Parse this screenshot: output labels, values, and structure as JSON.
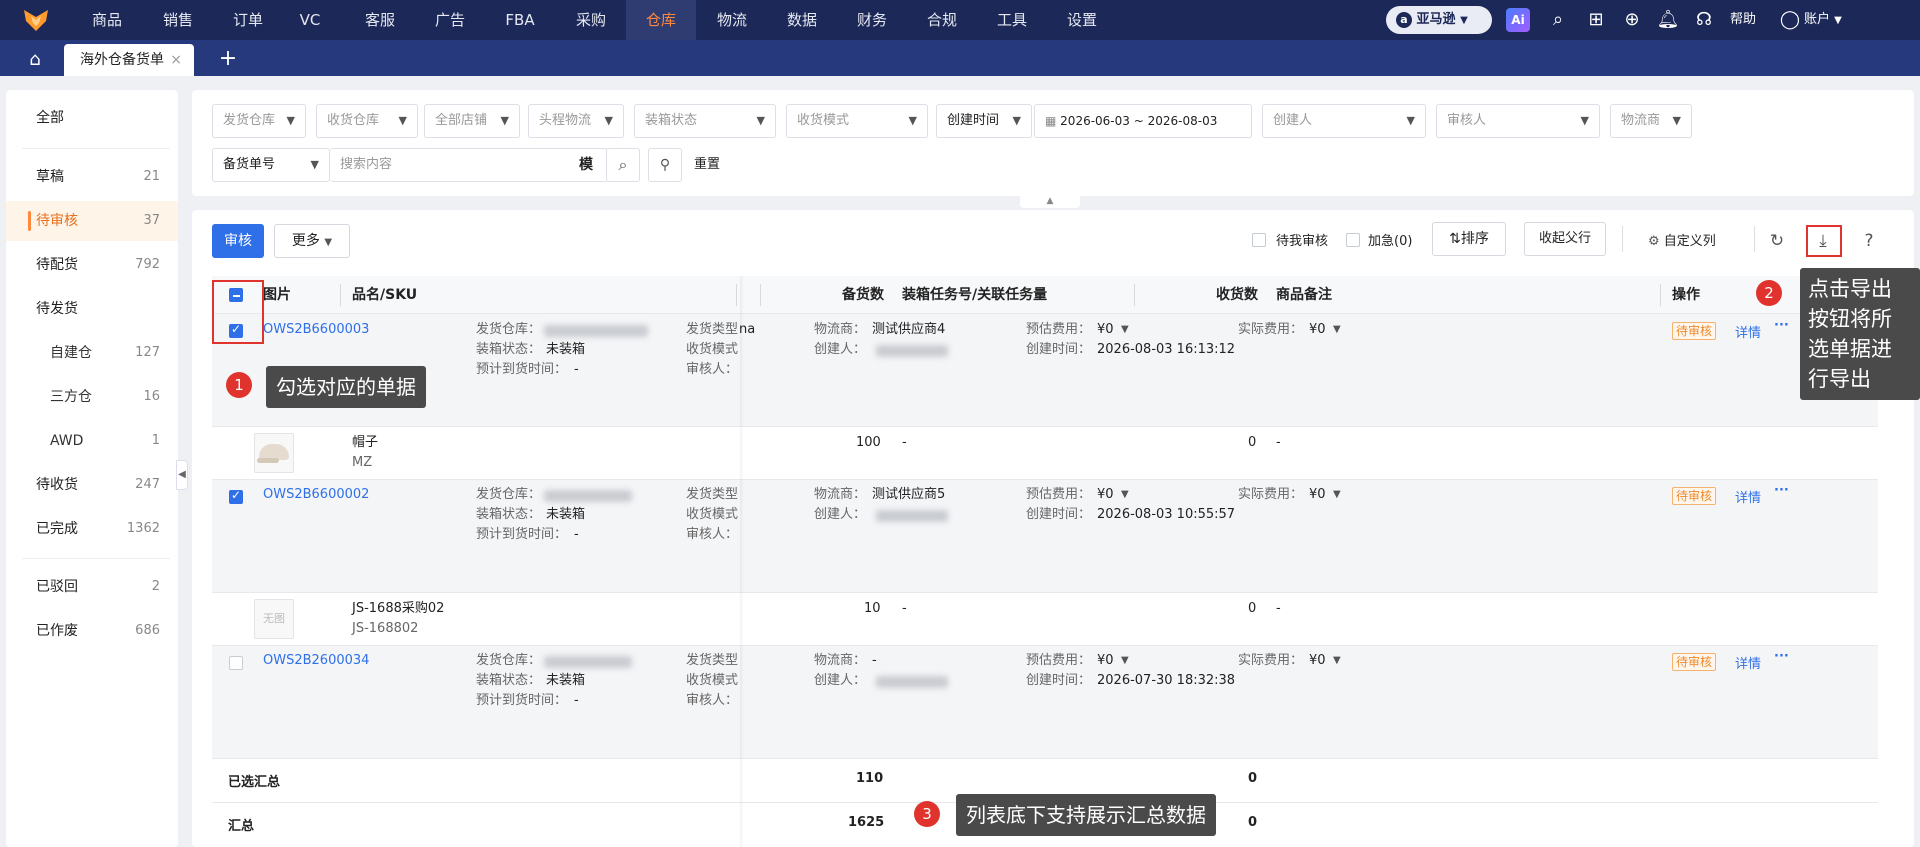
{
  "nav": {
    "items": [
      "商品",
      "销售",
      "订单",
      "VC",
      "客服",
      "广告",
      "FBA",
      "采购",
      "仓库",
      "物流",
      "数据",
      "财务",
      "合规",
      "工具",
      "设置"
    ],
    "active": "仓库",
    "marketplace": "亚马逊",
    "help": "帮助",
    "account": "账户"
  },
  "tabs": {
    "active_label": "海外仓备货单",
    "close": "×",
    "add": "+"
  },
  "sidebar": {
    "items": [
      {
        "label": "全部",
        "count": ""
      },
      {
        "label": "草稿",
        "count": "21"
      },
      {
        "label": "待审核",
        "count": "37"
      },
      {
        "label": "待配货",
        "count": "792"
      },
      {
        "label": "待发货",
        "count": ""
      },
      {
        "label": "自建仓",
        "count": "127"
      },
      {
        "label": "三方仓",
        "count": "16"
      },
      {
        "label": "AWD",
        "count": "1"
      },
      {
        "label": "待收货",
        "count": "247"
      },
      {
        "label": "已完成",
        "count": "1362"
      },
      {
        "label": "已驳回",
        "count": "2"
      },
      {
        "label": "已作废",
        "count": "686"
      }
    ]
  },
  "filters": {
    "ship_warehouse": "发货仓库",
    "receive_warehouse": "收货仓库",
    "all_stores": "全部店铺",
    "first_leg": "头程物流",
    "packing_status": "装箱状态",
    "receive_mode": "收货模式",
    "time_type": "创建时间",
    "date_range": "2026-06-03 ~ 2026-08-03",
    "creator": "创建人",
    "reviewer": "审核人",
    "carrier": "物流商",
    "search_field": "备货单号",
    "search_placeholder": "搜索内容",
    "mode_label": "模",
    "reset": "重置"
  },
  "toolbar": {
    "review": "审核",
    "more": "更多",
    "pending_mine": "待我审核",
    "urgent": "加急(0)",
    "sort": "排序",
    "collapse_parent": "收起父行",
    "custom_columns": "自定义列"
  },
  "table": {
    "headers": {
      "image": "图片",
      "name_sku": "品名/SKU",
      "stock_qty": "备货数",
      "packing_task": "装箱任务号/关联任务量",
      "received_qty": "收货数",
      "remark": "商品备注",
      "action": "操作"
    },
    "labels": {
      "ship_wh": "发货仓库：",
      "pack_status": "装箱状态：",
      "eta": "预计到货时间：",
      "ship_type": "发货类型",
      "recv_mode": "收货模式",
      "reviewer": "审核人：",
      "carrier": "物流商：",
      "creator": "创建人：",
      "est_fee": "预估费用：",
      "create_time": "创建时间：",
      "actual_fee": "实际费用：",
      "detail": "详情",
      "more": "···"
    },
    "rows": [
      {
        "order_no": "OWS2B6600003",
        "pack_status": "未装箱",
        "eta": "-",
        "carrier": "测试供应商4",
        "est_fee": "¥0",
        "create_time": "2026-08-03 16:13:12",
        "actual_fee": "¥0",
        "status": "待审核",
        "checked": true,
        "ship_type_suffix": "na",
        "sku": {
          "name": "帽子",
          "code": "MZ",
          "qty": "100",
          "task": "-",
          "received": "0",
          "remark": "-"
        }
      },
      {
        "order_no": "OWS2B6600002",
        "pack_status": "未装箱",
        "eta": "-",
        "carrier": "测试供应商5",
        "est_fee": "¥0",
        "create_time": "2026-08-03 10:55:57",
        "actual_fee": "¥0",
        "status": "待审核",
        "checked": true,
        "ship_type_suffix": "",
        "sku": {
          "name": "JS-1688采购02",
          "code": "JS-168802",
          "qty": "10",
          "task": "-",
          "received": "0",
          "remark": "-",
          "no_image": "无图"
        }
      },
      {
        "order_no": "OWS2B2600034",
        "pack_status": "未装箱",
        "eta": "-",
        "carrier": "-",
        "est_fee": "¥0",
        "create_time": "2026-07-30 18:32:38",
        "actual_fee": "¥0",
        "status": "待审核",
        "checked": false,
        "ship_type_suffix": ""
      }
    ],
    "summary": {
      "selected_label": "已选汇总",
      "selected_qty": "110",
      "selected_received": "0",
      "total_label": "汇总",
      "total_qty": "1625",
      "total_received": "0"
    }
  },
  "annotations": {
    "one": {
      "num": "1",
      "text": "勾选对应的单据"
    },
    "two": {
      "num": "2",
      "lines": [
        "点击导出",
        "按钮将所",
        "选单据进",
        "行导出"
      ]
    },
    "three": {
      "num": "3",
      "text": "列表底下支持展示汇总数据"
    }
  },
  "colors": {
    "nav_bg": "#1c2857",
    "tab_bg": "#26397c",
    "accent": "#ff8a3d",
    "primary": "#2f6fe8",
    "callout_red": "#e0332d"
  }
}
